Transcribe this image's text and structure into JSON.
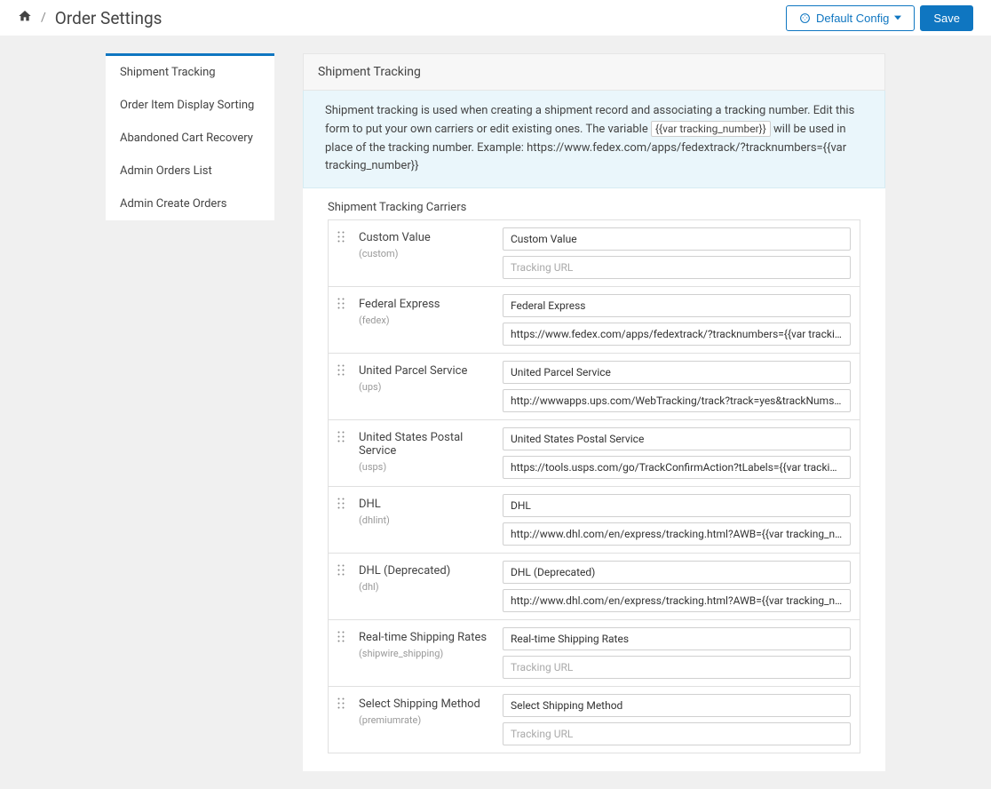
{
  "header": {
    "title": "Order Settings",
    "default_config_label": "Default Config",
    "save_label": "Save"
  },
  "sidebar": {
    "items": [
      {
        "label": "Shipment Tracking"
      },
      {
        "label": "Order Item Display Sorting"
      },
      {
        "label": "Abandoned Cart Recovery"
      },
      {
        "label": "Admin Orders List"
      },
      {
        "label": "Admin Create Orders"
      }
    ]
  },
  "panel": {
    "title": "Shipment Tracking",
    "info_before": "Shipment tracking is used when creating a shipment record and associating a tracking number. Edit this form to put your own carriers or edit existing ones. The variable ",
    "info_code": "{{var tracking_number}}",
    "info_after": " will be used in place of the tracking number. Example: https://www.fedex.com/apps/fedextrack/?tracknumbers={{var tracking_number}}",
    "section_title": "Shipment Tracking Carriers",
    "url_placeholder": "Tracking URL"
  },
  "carriers": [
    {
      "label": "Custom Value",
      "code": "(custom)",
      "name_value": "Custom Value",
      "url_value": ""
    },
    {
      "label": "Federal Express",
      "code": "(fedex)",
      "name_value": "Federal Express",
      "url_value": "https://www.fedex.com/apps/fedextrack/?tracknumbers={{var tracking_number}}"
    },
    {
      "label": "United Parcel Service",
      "code": "(ups)",
      "name_value": "United Parcel Service",
      "url_value": "http://wwwapps.ups.com/WebTracking/track?track=yes&trackNums={{var tracking_number}}"
    },
    {
      "label": "United States Postal Service",
      "code": "(usps)",
      "name_value": "United States Postal Service",
      "url_value": "https://tools.usps.com/go/TrackConfirmAction?tLabels={{var tracking_number}}"
    },
    {
      "label": "DHL",
      "code": "(dhlint)",
      "name_value": "DHL",
      "url_value": "http://www.dhl.com/en/express/tracking.html?AWB={{var tracking_number}}"
    },
    {
      "label": "DHL (Deprecated)",
      "code": "(dhl)",
      "name_value": "DHL (Deprecated)",
      "url_value": "http://www.dhl.com/en/express/tracking.html?AWB={{var tracking_number}}"
    },
    {
      "label": "Real-time Shipping Rates",
      "code": "(shipwire_shipping)",
      "name_value": "Real-time Shipping Rates",
      "url_value": ""
    },
    {
      "label": "Select Shipping Method",
      "code": "(premiumrate)",
      "name_value": "Select Shipping Method",
      "url_value": ""
    }
  ]
}
